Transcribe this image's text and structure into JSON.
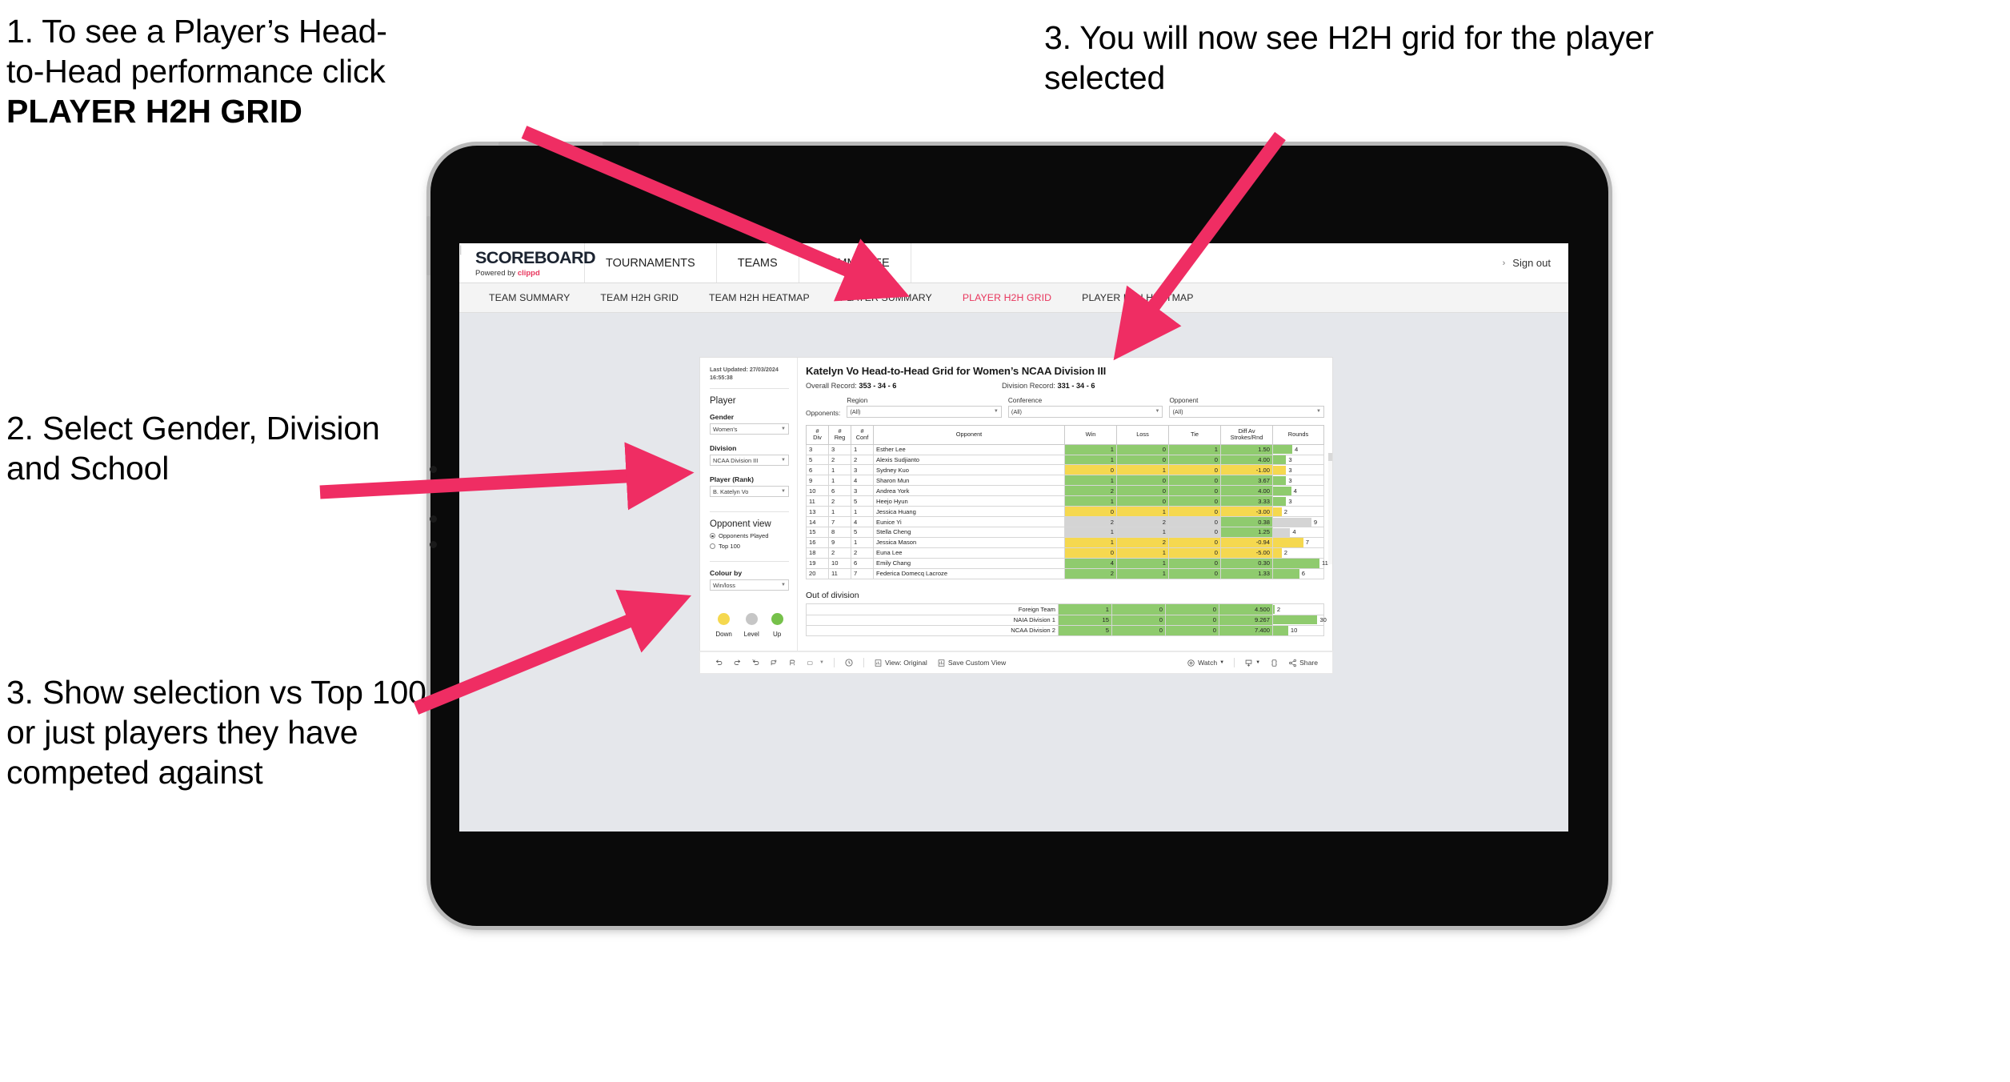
{
  "annotations": [
    {
      "id": "a1",
      "lines": [
        "1. To see a Player’s Head-",
        "to-Head performance click"
      ],
      "bold": "PLAYER H2H GRID"
    },
    {
      "id": "a2",
      "text": "2. Select Gender, Division and School"
    },
    {
      "id": "a3",
      "text": "3. Show selection vs Top 100 or just players they have competed against"
    },
    {
      "id": "a4",
      "text": "3. You will now see H2H grid for the player selected"
    }
  ],
  "colors": {
    "accent": "#e8365d",
    "green": "#8fcb6e",
    "yellow": "#f5d84f",
    "grey": "#d4d4d4"
  },
  "topnav": {
    "logo": "SCOREBOARD",
    "powered_prefix": "Powered by ",
    "powered_brand": "clippd",
    "items": [
      "TOURNAMENTS",
      "TEAMS",
      "COMMITTEE"
    ],
    "caret": "›",
    "divider": "|",
    "signout": "Sign out"
  },
  "subnav": {
    "items": [
      {
        "label": "TEAM SUMMARY",
        "active": false
      },
      {
        "label": "TEAM H2H GRID",
        "active": false
      },
      {
        "label": "TEAM H2H HEATMAP",
        "active": false
      },
      {
        "label": "PLAYER SUMMARY",
        "active": false
      },
      {
        "label": "PLAYER H2H GRID",
        "active": true
      },
      {
        "label": "PLAYER H2H HEATMAP",
        "active": false
      }
    ]
  },
  "filters": {
    "last_updated": "Last Updated: 27/03/2024 16:55:38",
    "player_heading": "Player",
    "gender_label": "Gender",
    "gender_value": "Women's",
    "division_label": "Division",
    "division_value": "NCAA Division III",
    "player_rank_label": "Player (Rank)",
    "player_rank_value": "B. Katelyn Vo",
    "opponent_view_heading": "Opponent view",
    "opponent_view_options": [
      {
        "label": "Opponents Played",
        "selected": true
      },
      {
        "label": "Top 100",
        "selected": false
      }
    ],
    "colour_by_label": "Colour by",
    "colour_by_value": "Win/loss",
    "legend": [
      {
        "label": "Down",
        "color": "#f5d84f"
      },
      {
        "label": "Level",
        "color": "#c6c6c6"
      },
      {
        "label": "Up",
        "color": "#76c14a"
      }
    ]
  },
  "viz": {
    "title": "Katelyn Vo Head-to-Head Grid for Women’s NCAA Division III",
    "overall_record_label": "Overall Record: ",
    "overall_record_value": "353 -  34 - 6",
    "division_record_label": "Division Record: ",
    "division_record_value": "331 -  34 - 6",
    "opponents_label": "Opponents:",
    "opponent_filters": [
      {
        "title": "Region",
        "value": "(All)"
      },
      {
        "title": "Conference",
        "value": "(All)"
      },
      {
        "title": "Opponent",
        "value": "(All)"
      }
    ],
    "out_of_division_title": "Out of division"
  },
  "chart_data": {
    "type": "table",
    "title": "Katelyn Vo Head-to-Head Grid for Women’s NCAA Division III",
    "columns": [
      "# Div",
      "# Reg",
      "# Conf",
      "Opponent",
      "Win",
      "Loss",
      "Tie",
      "Diff Av Strokes/Rnd",
      "Rounds"
    ],
    "column_header_lines": [
      [
        "#",
        "Div"
      ],
      [
        "#",
        "Reg"
      ],
      [
        "#",
        "Conf"
      ],
      [
        "Opponent"
      ],
      [
        "Win"
      ],
      [
        "Loss"
      ],
      [
        "Tie"
      ],
      [
        "Diff Av",
        "Strokes/Rnd"
      ],
      [
        "Rounds"
      ]
    ],
    "rows": [
      {
        "div": "3",
        "reg": "3",
        "conf": "1",
        "opponent": "Esther Lee",
        "win": "1",
        "loss": "0",
        "tie": "1",
        "diff": "1.50",
        "rounds": "4",
        "state": "up",
        "bar_pct": 38
      },
      {
        "div": "5",
        "reg": "2",
        "conf": "2",
        "opponent": "Alexis Sudjianto",
        "win": "1",
        "loss": "0",
        "tie": "0",
        "diff": "4.00",
        "rounds": "3",
        "state": "up",
        "bar_pct": 26
      },
      {
        "div": "6",
        "reg": "1",
        "conf": "3",
        "opponent": "Sydney Kuo",
        "win": "0",
        "loss": "1",
        "tie": "0",
        "diff": "-1.00",
        "rounds": "3",
        "state": "down",
        "bar_pct": 26
      },
      {
        "div": "9",
        "reg": "1",
        "conf": "4",
        "opponent": "Sharon Mun",
        "win": "1",
        "loss": "0",
        "tie": "0",
        "diff": "3.67",
        "rounds": "3",
        "state": "up",
        "bar_pct": 26
      },
      {
        "div": "10",
        "reg": "6",
        "conf": "3",
        "opponent": "Andrea York",
        "win": "2",
        "loss": "0",
        "tie": "0",
        "diff": "4.00",
        "rounds": "4",
        "state": "up",
        "bar_pct": 36
      },
      {
        "div": "11",
        "reg": "2",
        "conf": "5",
        "opponent": "Heejo Hyun",
        "win": "1",
        "loss": "0",
        "tie": "0",
        "diff": "3.33",
        "rounds": "3",
        "state": "up",
        "bar_pct": 26
      },
      {
        "div": "13",
        "reg": "1",
        "conf": "1",
        "opponent": "Jessica Huang",
        "win": "0",
        "loss": "1",
        "tie": "0",
        "diff": "-3.00",
        "rounds": "2",
        "state": "down",
        "bar_pct": 17
      },
      {
        "div": "14",
        "reg": "7",
        "conf": "4",
        "opponent": "Eunice Yi",
        "win": "2",
        "loss": "2",
        "tie": "0",
        "diff": "0.38",
        "rounds": "9",
        "state": "level",
        "bar_pct": 76,
        "diff_state": "up"
      },
      {
        "div": "15",
        "reg": "8",
        "conf": "5",
        "opponent": "Stella Cheng",
        "win": "1",
        "loss": "1",
        "tie": "0",
        "diff": "1.25",
        "rounds": "4",
        "state": "level",
        "bar_pct": 34,
        "diff_state": "up"
      },
      {
        "div": "16",
        "reg": "9",
        "conf": "1",
        "opponent": "Jessica Mason",
        "win": "1",
        "loss": "2",
        "tie": "0",
        "diff": "-0.94",
        "rounds": "7",
        "state": "down",
        "bar_pct": 60
      },
      {
        "div": "18",
        "reg": "2",
        "conf": "2",
        "opponent": "Euna Lee",
        "win": "0",
        "loss": "1",
        "tie": "0",
        "diff": "-5.00",
        "rounds": "2",
        "state": "down",
        "bar_pct": 17
      },
      {
        "div": "19",
        "reg": "10",
        "conf": "6",
        "opponent": "Emily Chang",
        "win": "4",
        "loss": "1",
        "tie": "0",
        "diff": "0.30",
        "rounds": "11",
        "state": "up",
        "bar_pct": 92
      },
      {
        "div": "20",
        "reg": "11",
        "conf": "7",
        "opponent": "Federica Domecq Lacroze",
        "win": "2",
        "loss": "1",
        "tie": "0",
        "diff": "1.33",
        "rounds": "6",
        "state": "up",
        "bar_pct": 52
      }
    ],
    "out_of_division": [
      {
        "name": "Foreign Team",
        "win": "1",
        "loss": "0",
        "tie": "0",
        "diff": "4.500",
        "rounds": "2",
        "state": "up",
        "bar_pct": 3
      },
      {
        "name": "NAIA Division 1",
        "win": "15",
        "loss": "0",
        "tie": "0",
        "diff": "9.267",
        "rounds": "30",
        "state": "up",
        "bar_pct": 88
      },
      {
        "name": "NCAA Division 2",
        "win": "5",
        "loss": "0",
        "tie": "0",
        "diff": "7.400",
        "rounds": "10",
        "state": "up",
        "bar_pct": 30
      }
    ]
  },
  "toolbar": {
    "view_label": "View: Original",
    "save_label": "Save Custom View",
    "watch_label": "Watch",
    "share_label": "Share",
    "caret": "▾"
  }
}
